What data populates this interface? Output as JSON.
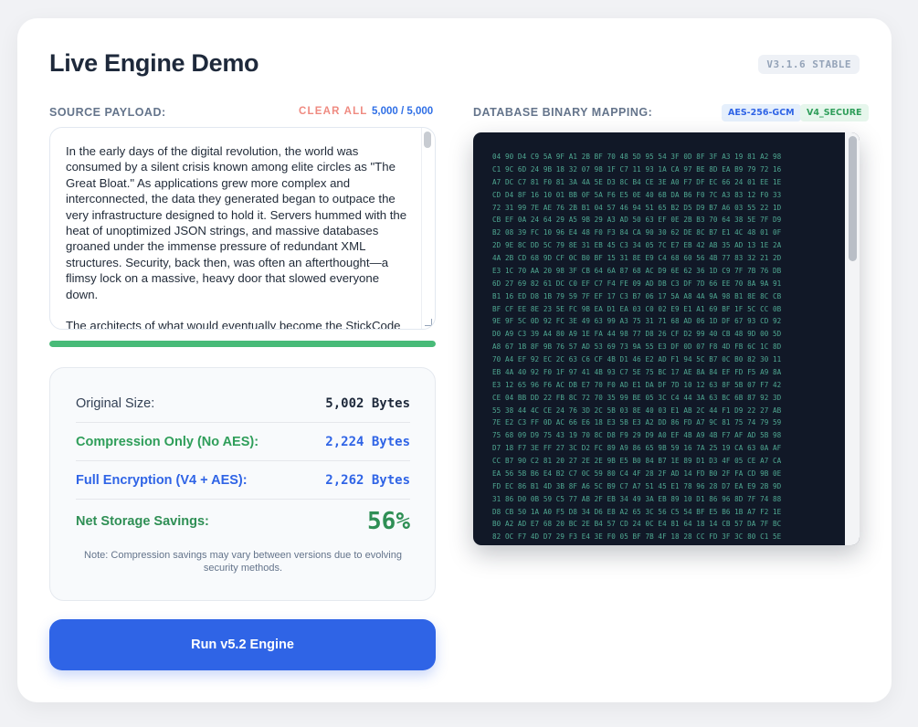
{
  "header": {
    "title": "Live Engine Demo",
    "version": "V3.1.6 STABLE"
  },
  "source": {
    "label": "SOURCE PAYLOAD:",
    "clear_label": "CLEAR ALL",
    "count": "5,000 / 5,000",
    "text": "In the early days of the digital revolution, the world was consumed by a silent crisis known among elite circles as \"The Great Bloat.\" As applications grew more complex and interconnected, the data they generated began to outpace the very infrastructure designed to hold it. Servers hummed with the heat of unoptimized JSON strings, and massive databases groaned under the immense pressure of redundant XML structures. Security, back then, was often an afterthought—a flimsy lock on a massive, heavy door that slowed everyone down.\n\nThe architects of what would eventually become the StickCode",
    "progress_percent": 100
  },
  "stats": {
    "original_label": "Original Size:",
    "original_value": "5,002 Bytes",
    "compression_label": "Compression Only (No AES):",
    "compression_value": "2,224 Bytes",
    "encryption_label": "Full Encryption (V4 + AES):",
    "encryption_value": "2,262 Bytes",
    "savings_label": "Net Storage Savings:",
    "savings_value": "56%",
    "note": "Note: Compression savings may vary between versions due to evolving security methods."
  },
  "run_button": {
    "label": "Run v5.2 Engine"
  },
  "mapping": {
    "label": "DATABASE BINARY MAPPING:",
    "tag_aes": "AES-256-GCM",
    "tag_secure": "V4_SECURE",
    "hex_lines": [
      "04 90 D4 C9 5A 9F A1 2B BF 70 48 5D 95 54 3F 0D 8F 3F A3 19 81 A2 98",
      "C1 9C 6D 24 9B 18 32 07 98 1F C7 11 93 1A CA 97 BE 8D EA B9 79 72 16",
      "A7 DC C7 81 F0 81 3A 4A 5E D3 8C B4 CE 3E A0 F7 DF EC 66 24 01 EE 1E",
      "CD D4 8F 16 10 01 BB 0F 5A F6 E5 0E 40 6B DA B6 F0 7C A3 83 12 F0 33",
      "72 31 99 7E AE 76 2B B1 04 57 46 94 51 65 B2 D5 D9 B7 A6 03 55 22 1D",
      "CB EF 0A 24 64 29 A5 9B 29 A3 AD 50 63 EF 0E 2B B3 70 64 38 5E 7F D9",
      "B2 08 39 FC 10 96 E4 48 F0 F3 84 CA 90 30 62 DE 8C B7 E1 4C 48 01 0F",
      "2D 9E 8C DD 5C 79 8E 31 EB 45 C3 34 05 7C E7 EB 42 AB 35 AD 13 1E 2A",
      "4A 2B CD 68 9D CF 0C B0 BF 15 31 8E E9 C4 68 60 56 4B 77 83 32 21 2D",
      "E3 1C 70 AA 20 98 3F CB 64 6A 87 68 AC D9 6E 62 36 1D C9 7F 7B 76 DB",
      "6D 27 69 82 61 DC C0 EF C7 F4 FE 09 AD DB C3 DF 7D 66 EE 70 8A 9A 91",
      "B1 16 ED D8 1B 79 59 7F EF 17 C3 B7 06 17 5A A8 4A 9A 98 B1 8E 8C CB",
      "BF CF EE 8E 23 5E FC 9B EA D1 EA 03 C0 02 E9 E1 A1 69 BF 1F 5C CC 0B",
      "9E 9F 5C 0D 92 FC 3E 49 63 99 A3 75 31 71 68 AD 06 1D DF 67 93 CD 92",
      "D0 A9 C3 39 A4 80 A9 1E FA 44 98 77 D8 26 CF D2 99 40 CB 48 9D 00 5D",
      "A8 67 1B 8F 9B 76 57 AD 53 69 73 9A 55 E3 DF 0D 07 F8 4D FB 6C 1C 8D",
      "70 A4 EF 92 EC 2C 63 C6 CF 4B D1 46 E2 AD F1 94 5C B7 0C B0 82 30 11",
      "EB 4A 40 92 F0 1F 97 41 4B 93 C7 5E 75 BC 17 AE 8A 84 EF FD F5 A9 8A",
      "E3 12 65 96 F6 AC DB E7 70 F0 AD E1 DA DF 7D 10 12 63 8F 5B 07 F7 42",
      "CE 04 BB DD 22 FB 8C 72 70 35 99 BE 05 3C C4 44 3A 63 BC 6B 87 92 3D",
      "55 38 44 4C CE 24 76 3D 2C 5B 03 8E 40 03 E1 AB 2C 44 F1 D9 22 27 AB",
      "7E E2 C3 FF 0D AC 66 E6 18 E3 5B E3 A2 DD 86 FD A7 9C 81 75 74 79 59",
      "75 68 09 D9 75 43 19 70 8C D8 F9 29 D9 A0 EF 4B A9 4B F7 AF AD 5B 98",
      "D7 18 F7 3E FF 27 3C D2 FC 89 A9 86 65 9B 59 16 7A 25 19 CA 63 0A AF",
      "CC B7 90 C2 81 20 27 2E 2E 9B E5 B0 84 B7 1E 89 D1 D3 4F 05 CE A7 CA",
      "EA 56 5B B6 E4 B2 C7 0C 59 80 C4 4F 28 2F AD 14 FD B0 2F FA CD 9B 0E",
      "FD EC 86 B1 4D 3B 8F A6 5C B9 C7 A7 51 45 E1 78 96 28 D7 EA E9 2B 9D",
      "31 86 D0 0B 59 C5 77 AB 2F EB 34 49 3A EB 89 10 D1 86 96 8D 7F 74 88",
      "D8 CB 50 1A A0 F5 D8 34 D6 E8 A2 65 3C 56 C5 54 BF E5 B6 1B A7 F2 1E",
      "B0 A2 AD E7 68 20 BC 2E B4 57 CD 24 0C E4 81 64 18 14 CB 57 DA 7F BC",
      "82 OC F7 4D D7 29 F3 E4 3E F0 05 BF 7B 4F 18 28 CC FD 3F 3C 80 C1 5E"
    ]
  },
  "colors": {
    "accent": "#2f64e6",
    "success": "#2f9e5a",
    "danger": "#ef8a80",
    "hex_text": "#4fa892"
  }
}
